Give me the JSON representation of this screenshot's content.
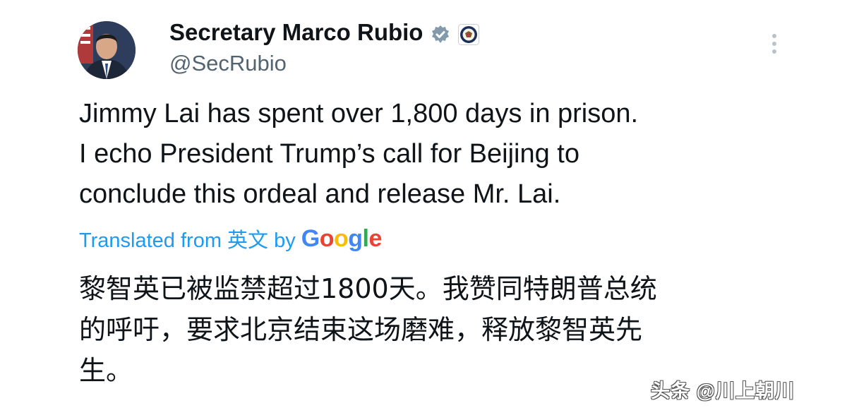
{
  "author": {
    "display_name": "Secretary Marco Rubio",
    "handle": "@SecRubio",
    "verified_badge_icon": "verified-badge-icon",
    "affiliation_icon": "state-department-seal-icon",
    "badge_color": "#829aab"
  },
  "more_icon": "more-vertical-icon",
  "tweet": {
    "lines": [
      "Jimmy Lai has spent over 1,800 days in prison.",
      "I echo President Trump’s call for Beijing to",
      "conclude this ordeal and release Mr. Lai."
    ]
  },
  "translation": {
    "label_prefix": "Translated from 英文 by",
    "provider_letters": [
      "G",
      "o",
      "o",
      "g",
      "l",
      "e"
    ],
    "lines": [
      "黎智英已被监禁超过1800天。我赞同特朗普总统",
      "的呼吁，要求北京结束这场磨难，释放黎智英先",
      "生。"
    ]
  },
  "watermark": {
    "text": "头条 @川上朝川"
  },
  "colors": {
    "text": "#0f1419",
    "secondary": "#536471",
    "link": "#1d9bf0",
    "google_blue": "#4285f4",
    "google_red": "#ea4335",
    "google_yellow": "#fbbc05",
    "google_green": "#34a853"
  }
}
